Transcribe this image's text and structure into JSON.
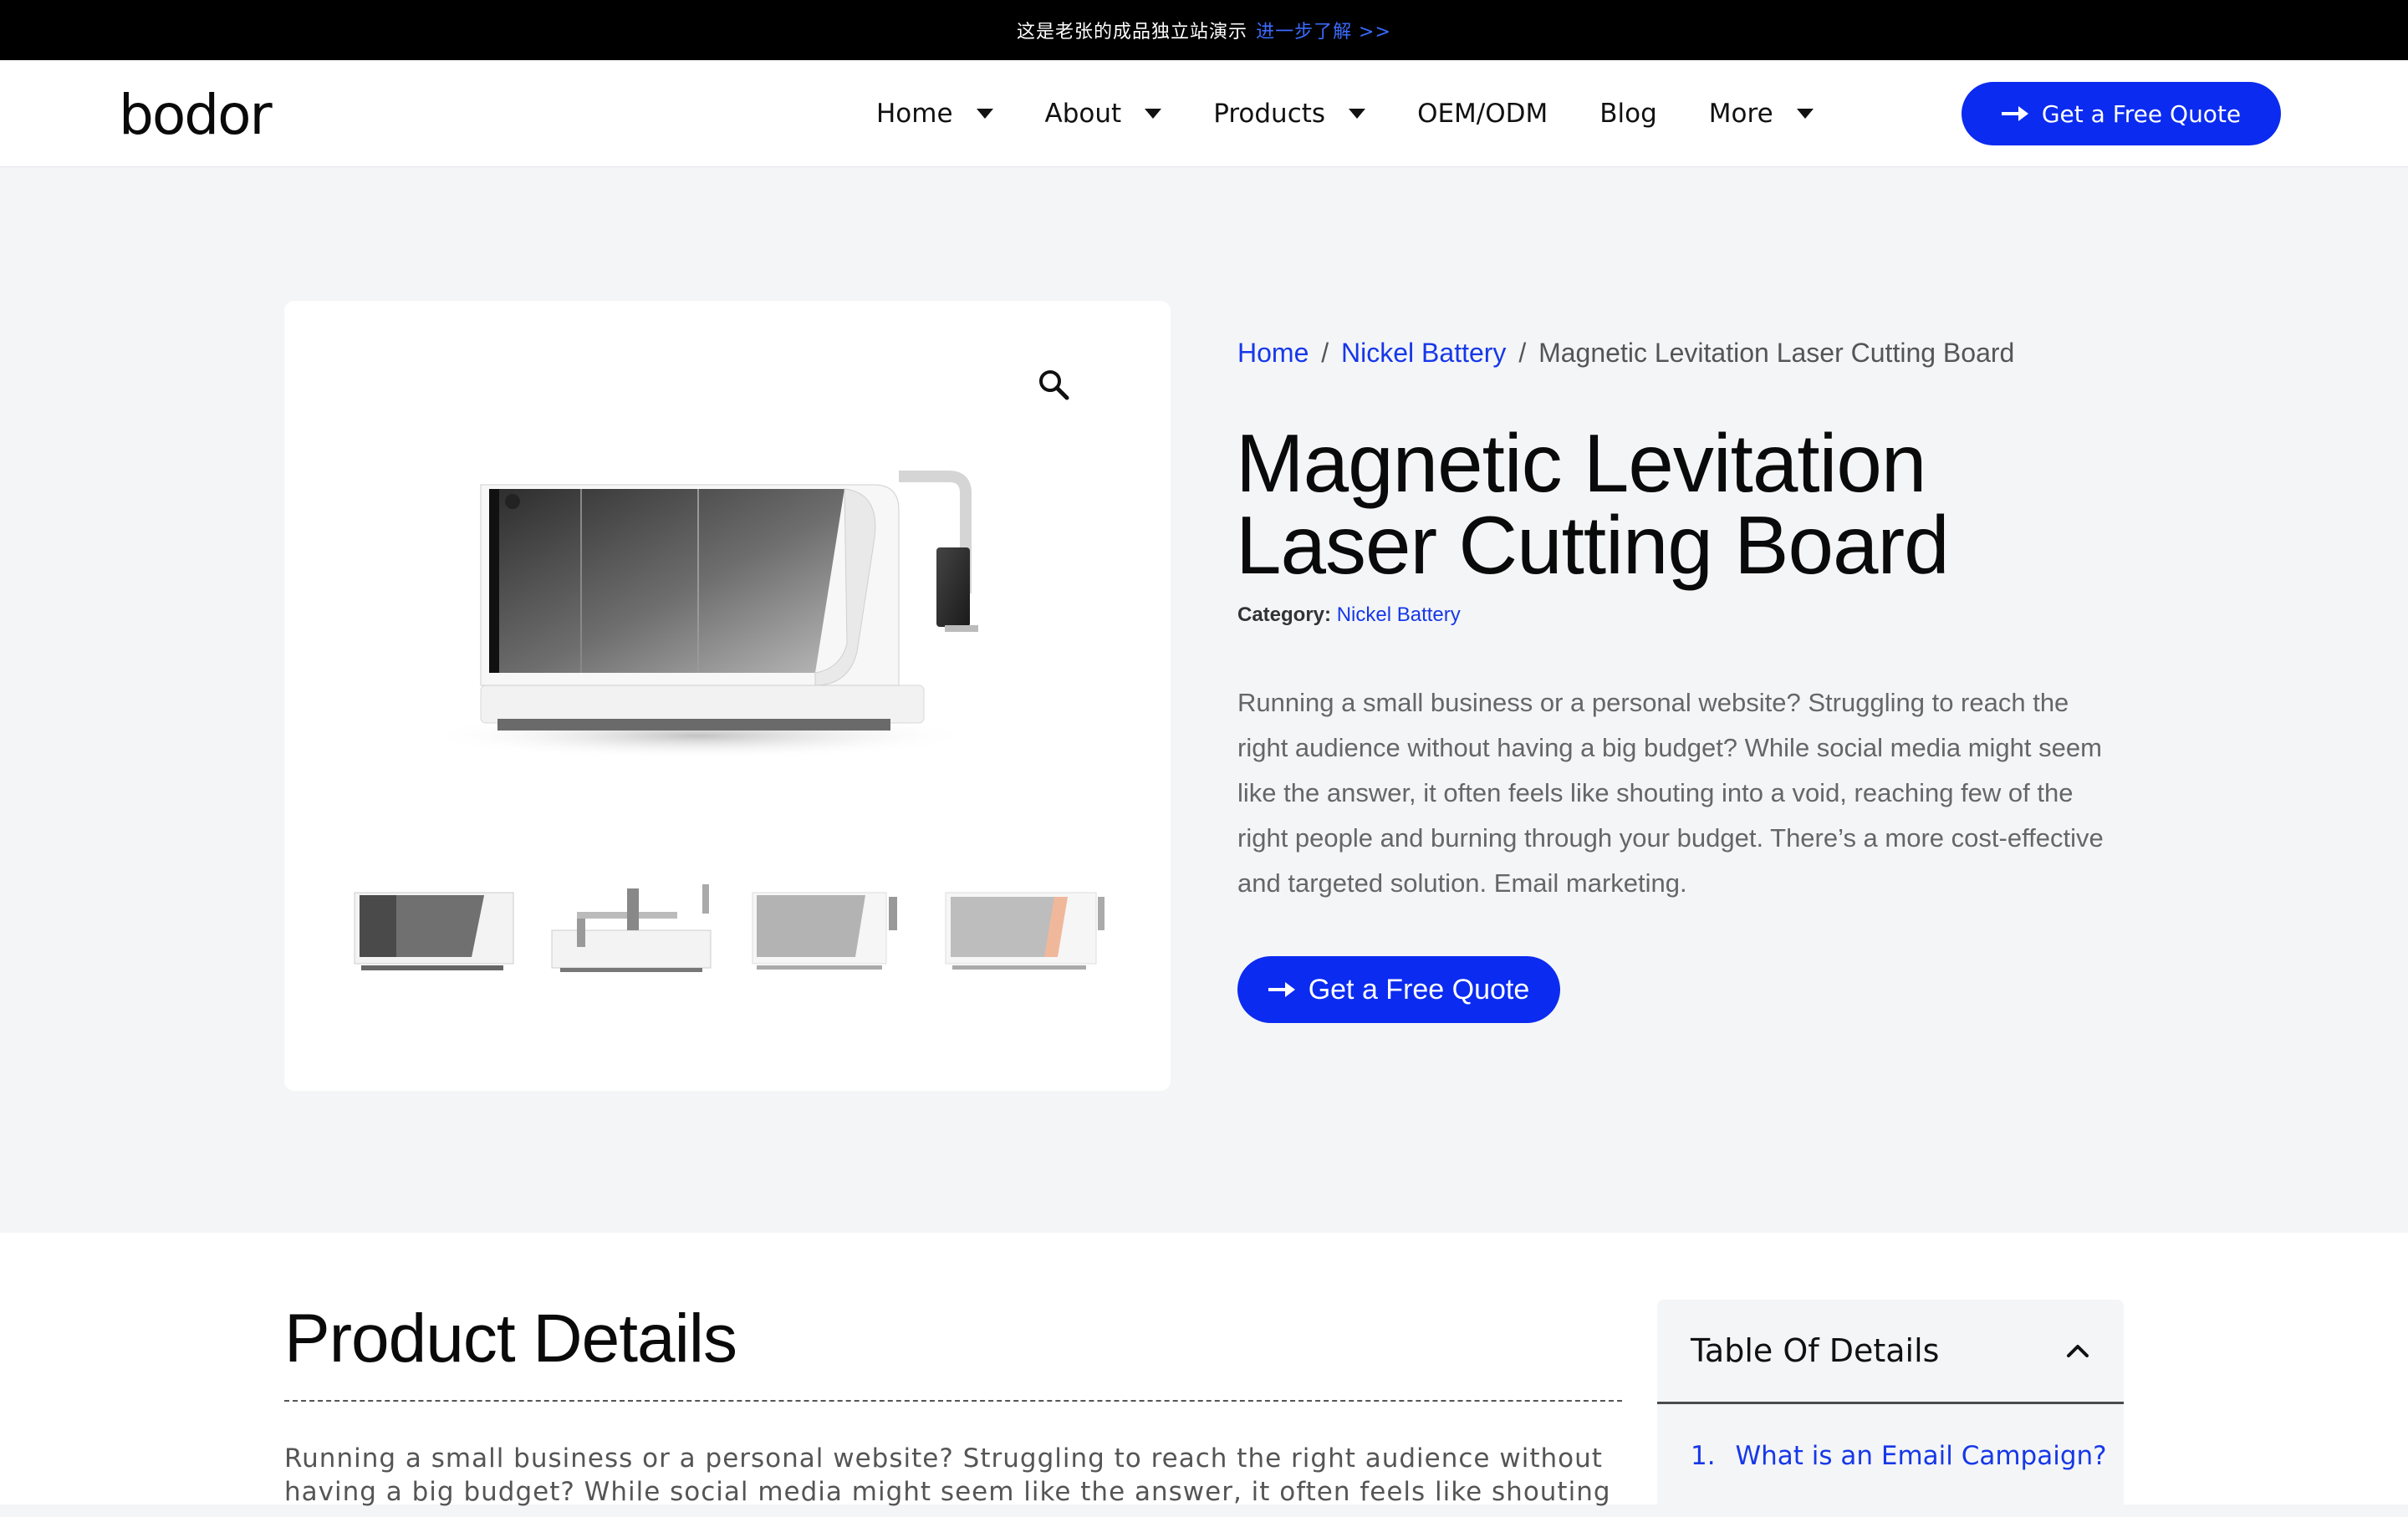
{
  "announcement": {
    "text": "这是老张的成品独立站演示",
    "link": "进一步了解 >>"
  },
  "header": {
    "logo": "bodor",
    "nav": [
      {
        "label": "Home",
        "has_dropdown": true
      },
      {
        "label": "About",
        "has_dropdown": true
      },
      {
        "label": "Products",
        "has_dropdown": true
      },
      {
        "label": "OEM/ODM",
        "has_dropdown": false
      },
      {
        "label": "Blog",
        "has_dropdown": false
      },
      {
        "label": "More",
        "has_dropdown": true
      }
    ],
    "cta": "Get a Free Quote"
  },
  "gallery": {
    "zoom_icon": "magnifier-icon",
    "thumbnail_count": 4
  },
  "product": {
    "breadcrumb": {
      "home": "Home",
      "sep": "/",
      "category": "Nickel Battery",
      "current": "Magnetic Levitation Laser Cutting Board"
    },
    "title_line1": "Magnetic Levitation",
    "title_line2": "Laser Cutting Board",
    "category_label": "Category:",
    "category": "Nickel Battery",
    "description": "Running a small business or a personal website? Struggling to reach the right audience without having a big budget? While social media might seem like the answer, it often feels like shouting into a void, reaching few of the right people and burning through your budget. There’s a more cost-effective and targeted solution. Email marketing.",
    "cta": "Get a Free Quote"
  },
  "details": {
    "title": "Product Details",
    "text": "Running a small business or a personal website? Struggling to reach the right audience without having a big budget? While social media might seem like the answer, it often feels like shouting"
  },
  "toc": {
    "title": "Table Of Details",
    "items": [
      {
        "num": "1.",
        "label": "What is an Email Campaign?"
      }
    ]
  },
  "colors": {
    "accent": "#0b2bf0",
    "link": "#1638e8",
    "page_bg": "#f4f5f7"
  }
}
